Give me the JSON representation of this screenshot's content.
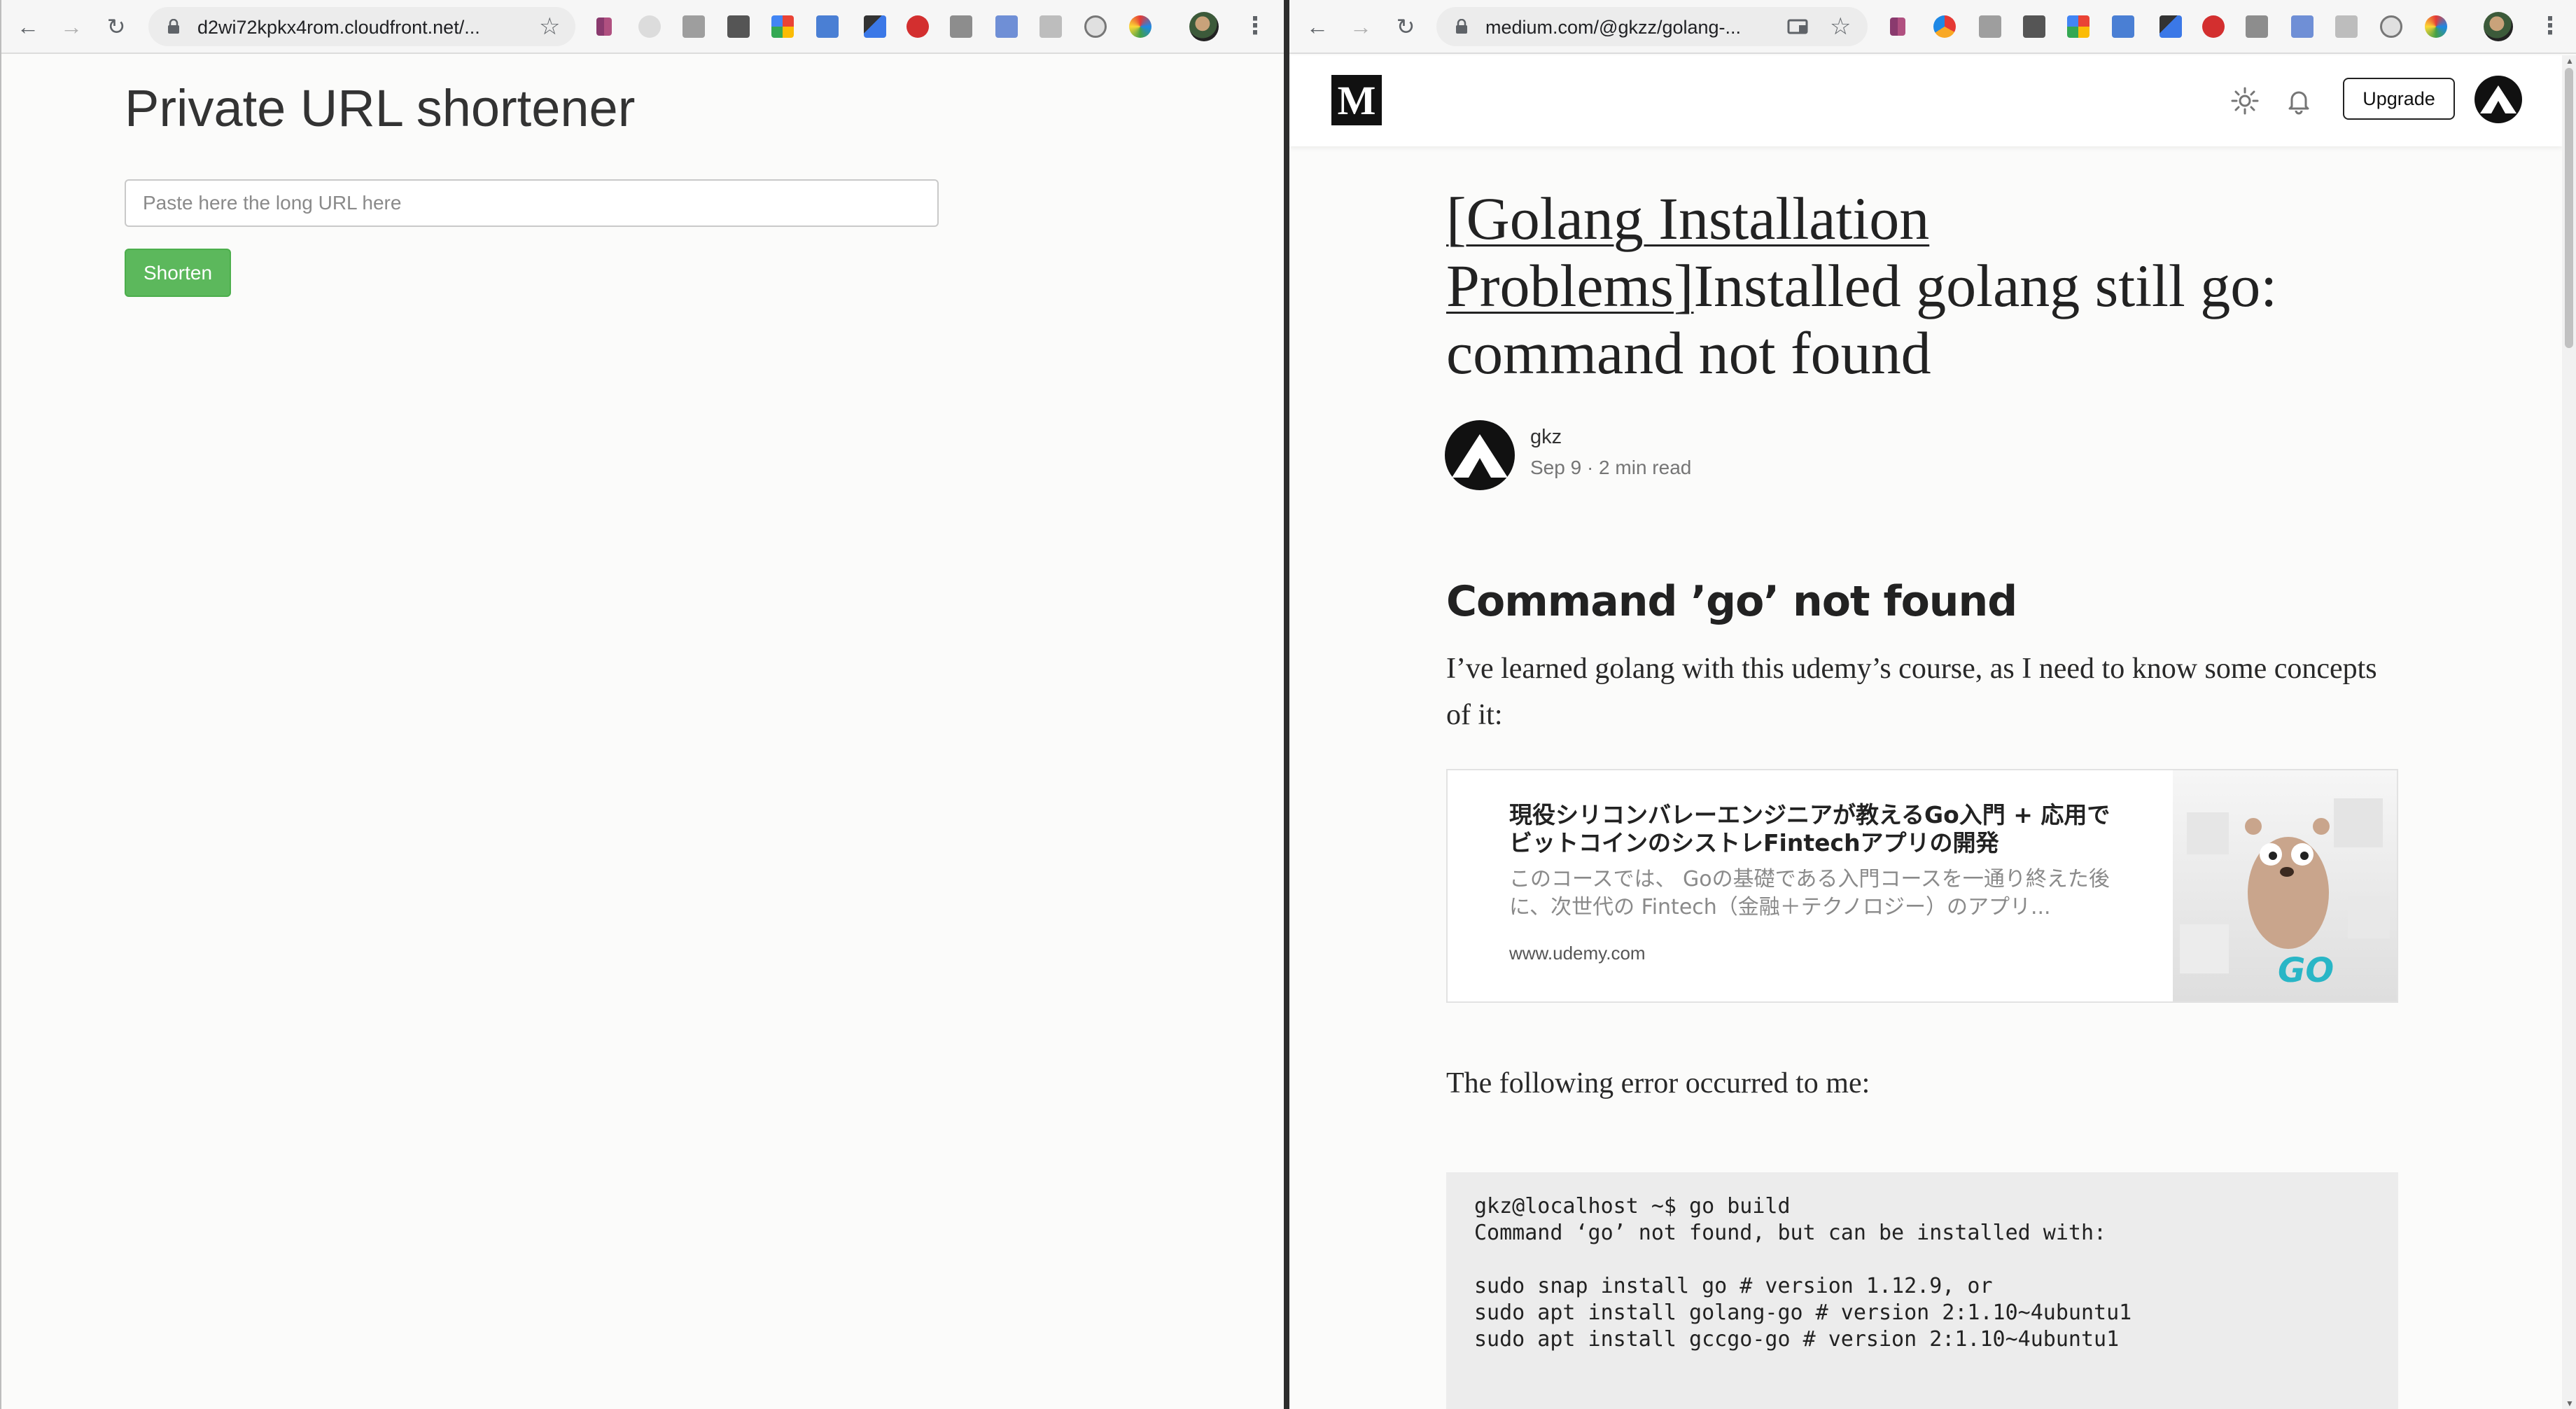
{
  "left_browser": {
    "address": "d2wi72kpkx4rom.cloudfront.net/...",
    "page": {
      "title": "Private URL shortener",
      "input_placeholder": "Paste here the long URL here",
      "button_label": "Shorten"
    }
  },
  "right_browser": {
    "address": "medium.com/@gkzz/golang-...",
    "header": {
      "logo": "M",
      "upgrade_label": "Upgrade"
    },
    "article": {
      "title_link": "[Golang Installation Problems]",
      "title_rest": "Installed golang still go: command not found",
      "author": "gkz",
      "meta": "Sep 9 · 2 min read",
      "section_heading": "Command ’go’ not found",
      "intro": "I’ve learned golang with this udemy’s course, as I need to know some concepts of it:",
      "embed": {
        "title": "現役シリコンバレーエンジニアが教えるGo入門 + 応用でビットコインのシストレFintechアプリの開発",
        "description": "このコースでは、 Goの基礎である入門コースを一通り終えた後に、次世代の Fintech（金融＋テクノロジー）のアプリ...",
        "host": "www.udemy.com",
        "thumb_text": "GO"
      },
      "error_intro": "The following error occurred to me:",
      "code": "gkz@localhost ~$ go build\nCommand ‘go’ not found, but can be installed with:\n\nsudo snap install go # version 1.12.9, or\nsudo apt install golang-go # version 2:1.10~4ubuntu1\nsudo apt install gccgo-go # version 2:1.10~4ubuntu1"
    }
  },
  "icons": [
    "back-icon",
    "forward-icon",
    "reload-icon",
    "lock-icon",
    "star-icon",
    "cast-icon",
    "menu-icon",
    "settings-icon",
    "bell-icon"
  ],
  "colors": {
    "shorten_button": "#5cb85c",
    "medium_logo": "#111111",
    "code_background": "#ececec"
  }
}
